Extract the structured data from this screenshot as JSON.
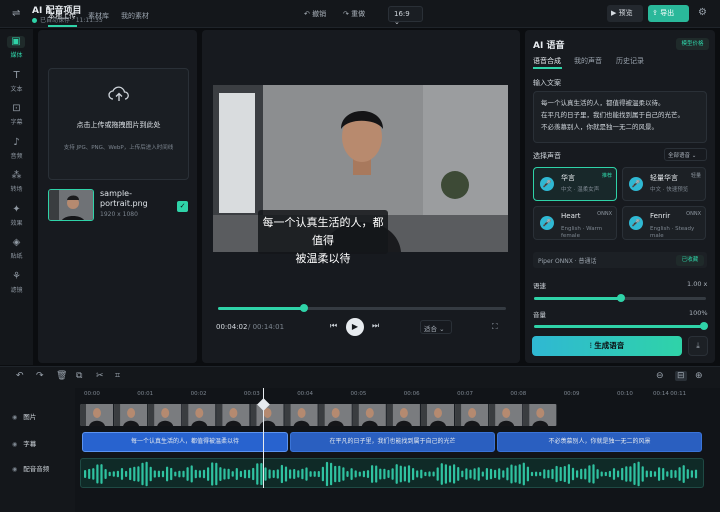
{
  "header": {
    "title": "AI 配音项目",
    "saved": "已自动保存 · 11:11:35",
    "undo": "撤销",
    "redo": "重做",
    "ratio": "16:9",
    "preview": "预览",
    "export": "导出"
  },
  "rail": {
    "items": [
      {
        "label": "媒体",
        "icon": "image-icon",
        "glyph": "▣"
      },
      {
        "label": "文本",
        "icon": "text-icon",
        "glyph": "T"
      },
      {
        "label": "字幕",
        "icon": "caption-icon",
        "glyph": "⊡"
      },
      {
        "label": "音频",
        "icon": "music-icon",
        "glyph": "♪"
      },
      {
        "label": "转场",
        "icon": "transition-icon",
        "glyph": "⁂"
      },
      {
        "label": "效果",
        "icon": "sparkle-icon",
        "glyph": "✦"
      },
      {
        "label": "贴纸",
        "icon": "sticker-icon",
        "glyph": "◈"
      },
      {
        "label": "滤镜",
        "icon": "filter-icon",
        "glyph": "⚘"
      }
    ]
  },
  "media": {
    "tabs": [
      "本地上传",
      "素材库",
      "我的素材"
    ],
    "upload_title": "点击上传或拖拽图片到此处",
    "upload_sub": "支持 JPG、PNG、WebP，上传后进入时间线",
    "file_name": "sample-portrait.png",
    "file_size": "1920 x 1080"
  },
  "player": {
    "subtitle_line1": "每一个认真生活的人，都值得",
    "subtitle_line2": "被温柔以待",
    "time_current": "00:04:02",
    "time_total": "/ 00:14:01",
    "fit": "适合",
    "progress": 0.3
  },
  "ai": {
    "title": "AI 语音",
    "model_badge": "模型价格",
    "tabs": [
      "语音合成",
      "我的声音",
      "历史记录"
    ],
    "input_label": "输入文案",
    "text_lines": [
      "每一个认真生活的人，都值得被温柔以待。",
      "在平凡的日子里，我们也能找到属于自己的光芒。",
      "不必羡慕别人，你就是独一无二的风景。"
    ],
    "voice_label": "选择声音",
    "lang": "全部语音",
    "voices": [
      {
        "name": "华言",
        "desc": "中文 · 温柔女声",
        "tag": "推荐"
      },
      {
        "name": "轻量华言",
        "desc": "中文 · 快速预览",
        "tag": "轻量"
      },
      {
        "name": "Heart",
        "desc": "English · Warm female",
        "tag": "ONNX"
      },
      {
        "name": "Fenrir",
        "desc": "English · Steady male",
        "tag": "ONNX"
      }
    ],
    "engine": "Piper ONNX · 普通话",
    "engine_badge": "已收藏",
    "speed_label": "语速",
    "speed_value": "1.00 x",
    "volume_label": "音量",
    "volume_value": "100%",
    "generate": "生成语音"
  },
  "timeline": {
    "ruler": [
      "00:00",
      "00:01",
      "00:02",
      "00:03",
      "00:04",
      "00:05",
      "00:06",
      "00:07",
      "00:08",
      "00:09",
      "00:10",
      "00:11",
      "00:12",
      "00:14"
    ],
    "tracks": [
      "图片",
      "字幕",
      "配音音频"
    ],
    "segments": [
      "每一个认真生活的人，都值得被温柔以待",
      "在平凡的日子里，我们也能找到属于自己的光芒",
      "不必羡慕别人，你就是独一无二的风景"
    ]
  }
}
